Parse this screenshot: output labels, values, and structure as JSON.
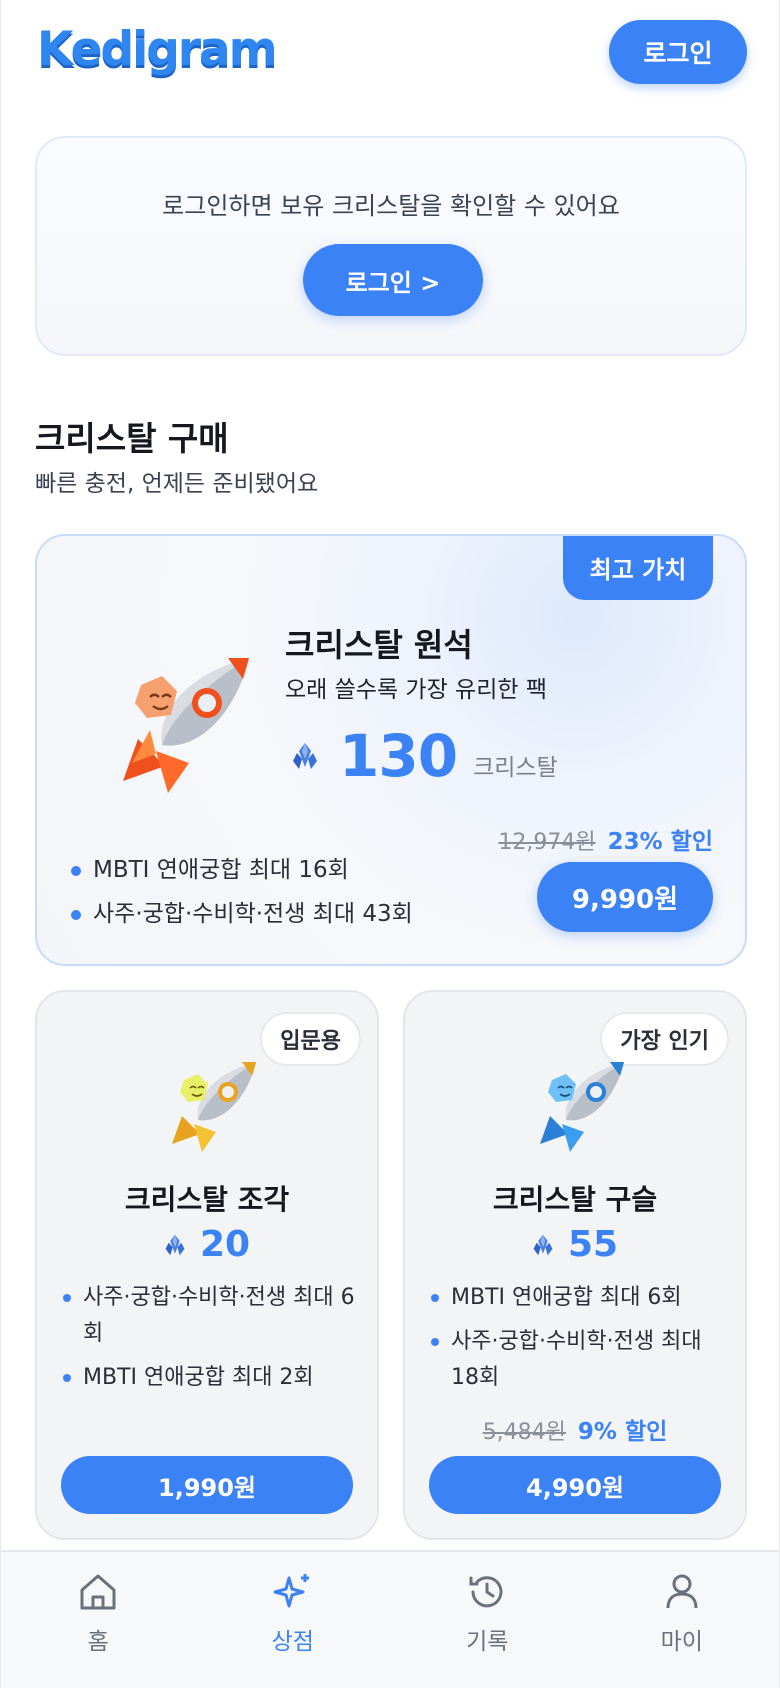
{
  "app": {
    "logo": "Kedigram"
  },
  "header": {
    "login_label": "로그인"
  },
  "login_card": {
    "message": "로그인하면 보유 크리스탈을 확인할 수 있어요",
    "button_label": "로그인 >"
  },
  "section": {
    "title": "크리스탈 구매",
    "subtitle": "빠른 충전, 언제든 준비됐어요"
  },
  "featured": {
    "badge": "최고 가치",
    "title": "크리스탈 원석",
    "description": "오래 쓸수록 가장 유리한 팩",
    "amount": "130",
    "unit": "크리스탈",
    "original_price": "12,974원",
    "discount": "23% 할인",
    "price": "9,990원",
    "benefits": [
      "MBTI 연애궁합 최대 16회",
      "사주·궁합·수비학·전생 최대 43회"
    ],
    "rocket_color": "#f26b3a"
  },
  "small_cards": [
    {
      "badge": "입문용",
      "title": "크리스탈 조각",
      "amount": "20",
      "benefits": [
        "사주·궁합·수비학·전생 최대 6회",
        "MBTI 연애궁합 최대 2회"
      ],
      "price": "1,990원",
      "rocket_color": "#f3c233"
    },
    {
      "badge": "가장 인기",
      "title": "크리스탈 구슬",
      "amount": "55",
      "benefits": [
        "MBTI 연애궁합 최대 6회",
        "사주·궁합·수비학·전생 최대 18회"
      ],
      "original_price": "5,484원",
      "discount": "9% 할인",
      "price": "4,990원",
      "rocket_color": "#3b9cf0"
    }
  ],
  "nav": [
    {
      "label": "홈",
      "icon": "home-icon",
      "active": false
    },
    {
      "label": "상점",
      "icon": "sparkle-icon",
      "active": true
    },
    {
      "label": "기록",
      "icon": "history-icon",
      "active": false
    },
    {
      "label": "마이",
      "icon": "user-icon",
      "active": false
    }
  ],
  "colors": {
    "accent": "#3b82f6",
    "logo": "#2f86f0"
  }
}
